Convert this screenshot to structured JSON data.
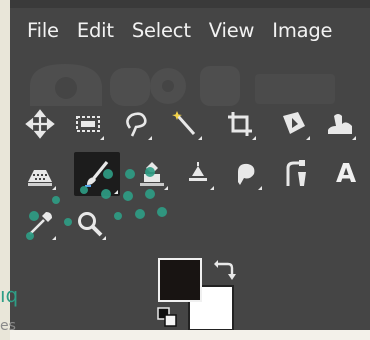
{
  "menubar": {
    "items": [
      "File",
      "Edit",
      "Select",
      "View",
      "Image"
    ]
  },
  "toolbox": {
    "row1": [
      "move-icon",
      "rect-select-icon",
      "free-select-icon",
      "fuzzy-select-icon",
      "crop-icon",
      "unified-transform-icon",
      "warp-transform-icon"
    ],
    "row2": [
      "bucket-fill-icon",
      "paintbrush-icon",
      "clone-icon",
      "heal-icon",
      "smudge-icon",
      "paths-icon",
      "text-icon"
    ],
    "row3": [
      "color-picker-icon",
      "zoom-icon"
    ],
    "active_tool": "paintbrush-icon",
    "text_tool_label": "A"
  },
  "colors": {
    "foreground": "#181412",
    "background": "#ffffff",
    "ui_background": "#454545",
    "watermark": "#2e9e86"
  },
  "watermark": {
    "line1": "ıq",
    "line2": "es"
  }
}
